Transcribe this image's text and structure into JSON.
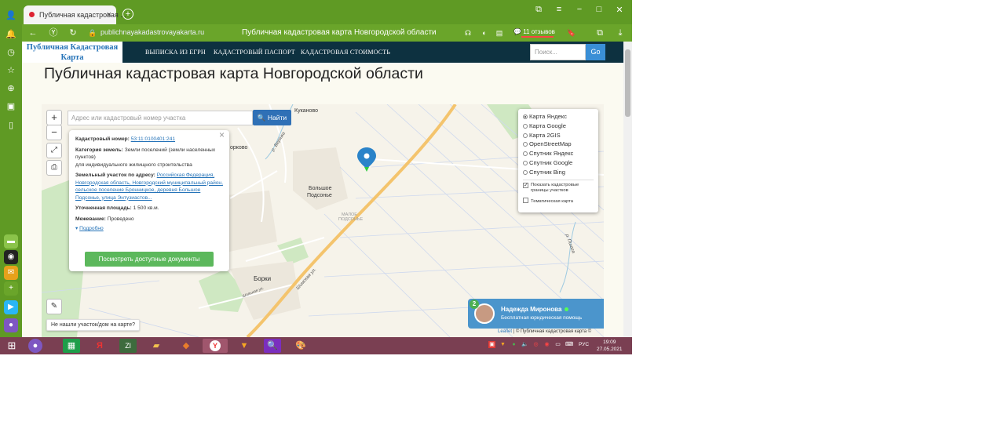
{
  "browser": {
    "tab_title": "Публичная кадастровая ...",
    "tab_close": "×",
    "new_tab": "+",
    "url": "publichnayakadastrovayakarta.ru",
    "page_title": "Публичная кадастровая карта Новгородской области",
    "reviews": "11 отзывов"
  },
  "site": {
    "logo_line1": "Публичная Кадастровая",
    "logo_line2": "Карта",
    "nav": [
      "ВЫПИСКА ИЗ ЕГРН",
      "КАДАСТРОВЫЙ ПАСПОРТ",
      "КАДАСТРОВАЯ СТОИМОСТЬ"
    ],
    "search_placeholder": "Поиск...",
    "go": "Go",
    "heading": "Публичная кадастровая карта Новгородской области"
  },
  "map": {
    "zoom_in": "+",
    "zoom_out": "−",
    "address_placeholder": "Адрес или кадастровый номер участка",
    "find": "Найти",
    "labels": {
      "kukanovo": "Куканово",
      "borkovo": "орково",
      "bolshoe1": "Большое",
      "bolshoe2": "Подсонье",
      "maloe1": "МАЛОЕ",
      "maloe2": "ПОДСОНЬЕ",
      "borki": "Борки",
      "river1": "р. Веряжа",
      "river2": "р. Пшага",
      "street1": "Шимская ул.",
      "street2": "Шольная ул."
    },
    "not_found": "Не нашли участок/дом на карте?",
    "attribution_leaflet": "Leaflet",
    "attribution_rest": " | © Публичная кадастровая карта ©"
  },
  "popup": {
    "cad_label": "Кадастровый номер:",
    "cad_value": "53:11:0100401:241",
    "cat_label": "Категория земель:",
    "cat_value": "Земли поселений (земли населенных пунктов)",
    "cat_use": "для индивидуального жилищного строительства",
    "addr_label": "Земельный участок по адресу:",
    "addr_value": "Российская Федерация, Новгородская область, Новгородский муниципальный район, сельское поселение Бронницкое, деревня Большое Подсонье, улица Энтузиастов...",
    "area_label": "Уточненная площадь:",
    "area_value": "1 500 кв.м.",
    "survey_label": "Межевание:",
    "survey_value": "Проведено",
    "more": "Подробно",
    "docs_button": "Посмотреть доступные документы",
    "close": "×"
  },
  "layers": {
    "options": [
      "Карта Яндекс",
      "Карта Google",
      "Карта 2GIS",
      "OpenStreetMap",
      "Спутник Яндекс",
      "Спутник Google",
      "Спутник Bing"
    ],
    "selected": "Карта Яндекс",
    "show_borders": "Показать кадастровые границы участков",
    "thematic": "Тематическая карта"
  },
  "chat": {
    "badge": "2",
    "name": "Надежда Миронова",
    "subtitle": "Бесплатная юридическая помощь"
  },
  "taskbar": {
    "lang": "РУС",
    "time": "19:09",
    "date": "27.05.2021"
  },
  "colors": {
    "browser_green": "#5f9a24",
    "navbar": "#0d3140",
    "accent_blue": "#2f70b6",
    "docs_green": "#5cb85c",
    "taskbar": "#7a3f52"
  }
}
